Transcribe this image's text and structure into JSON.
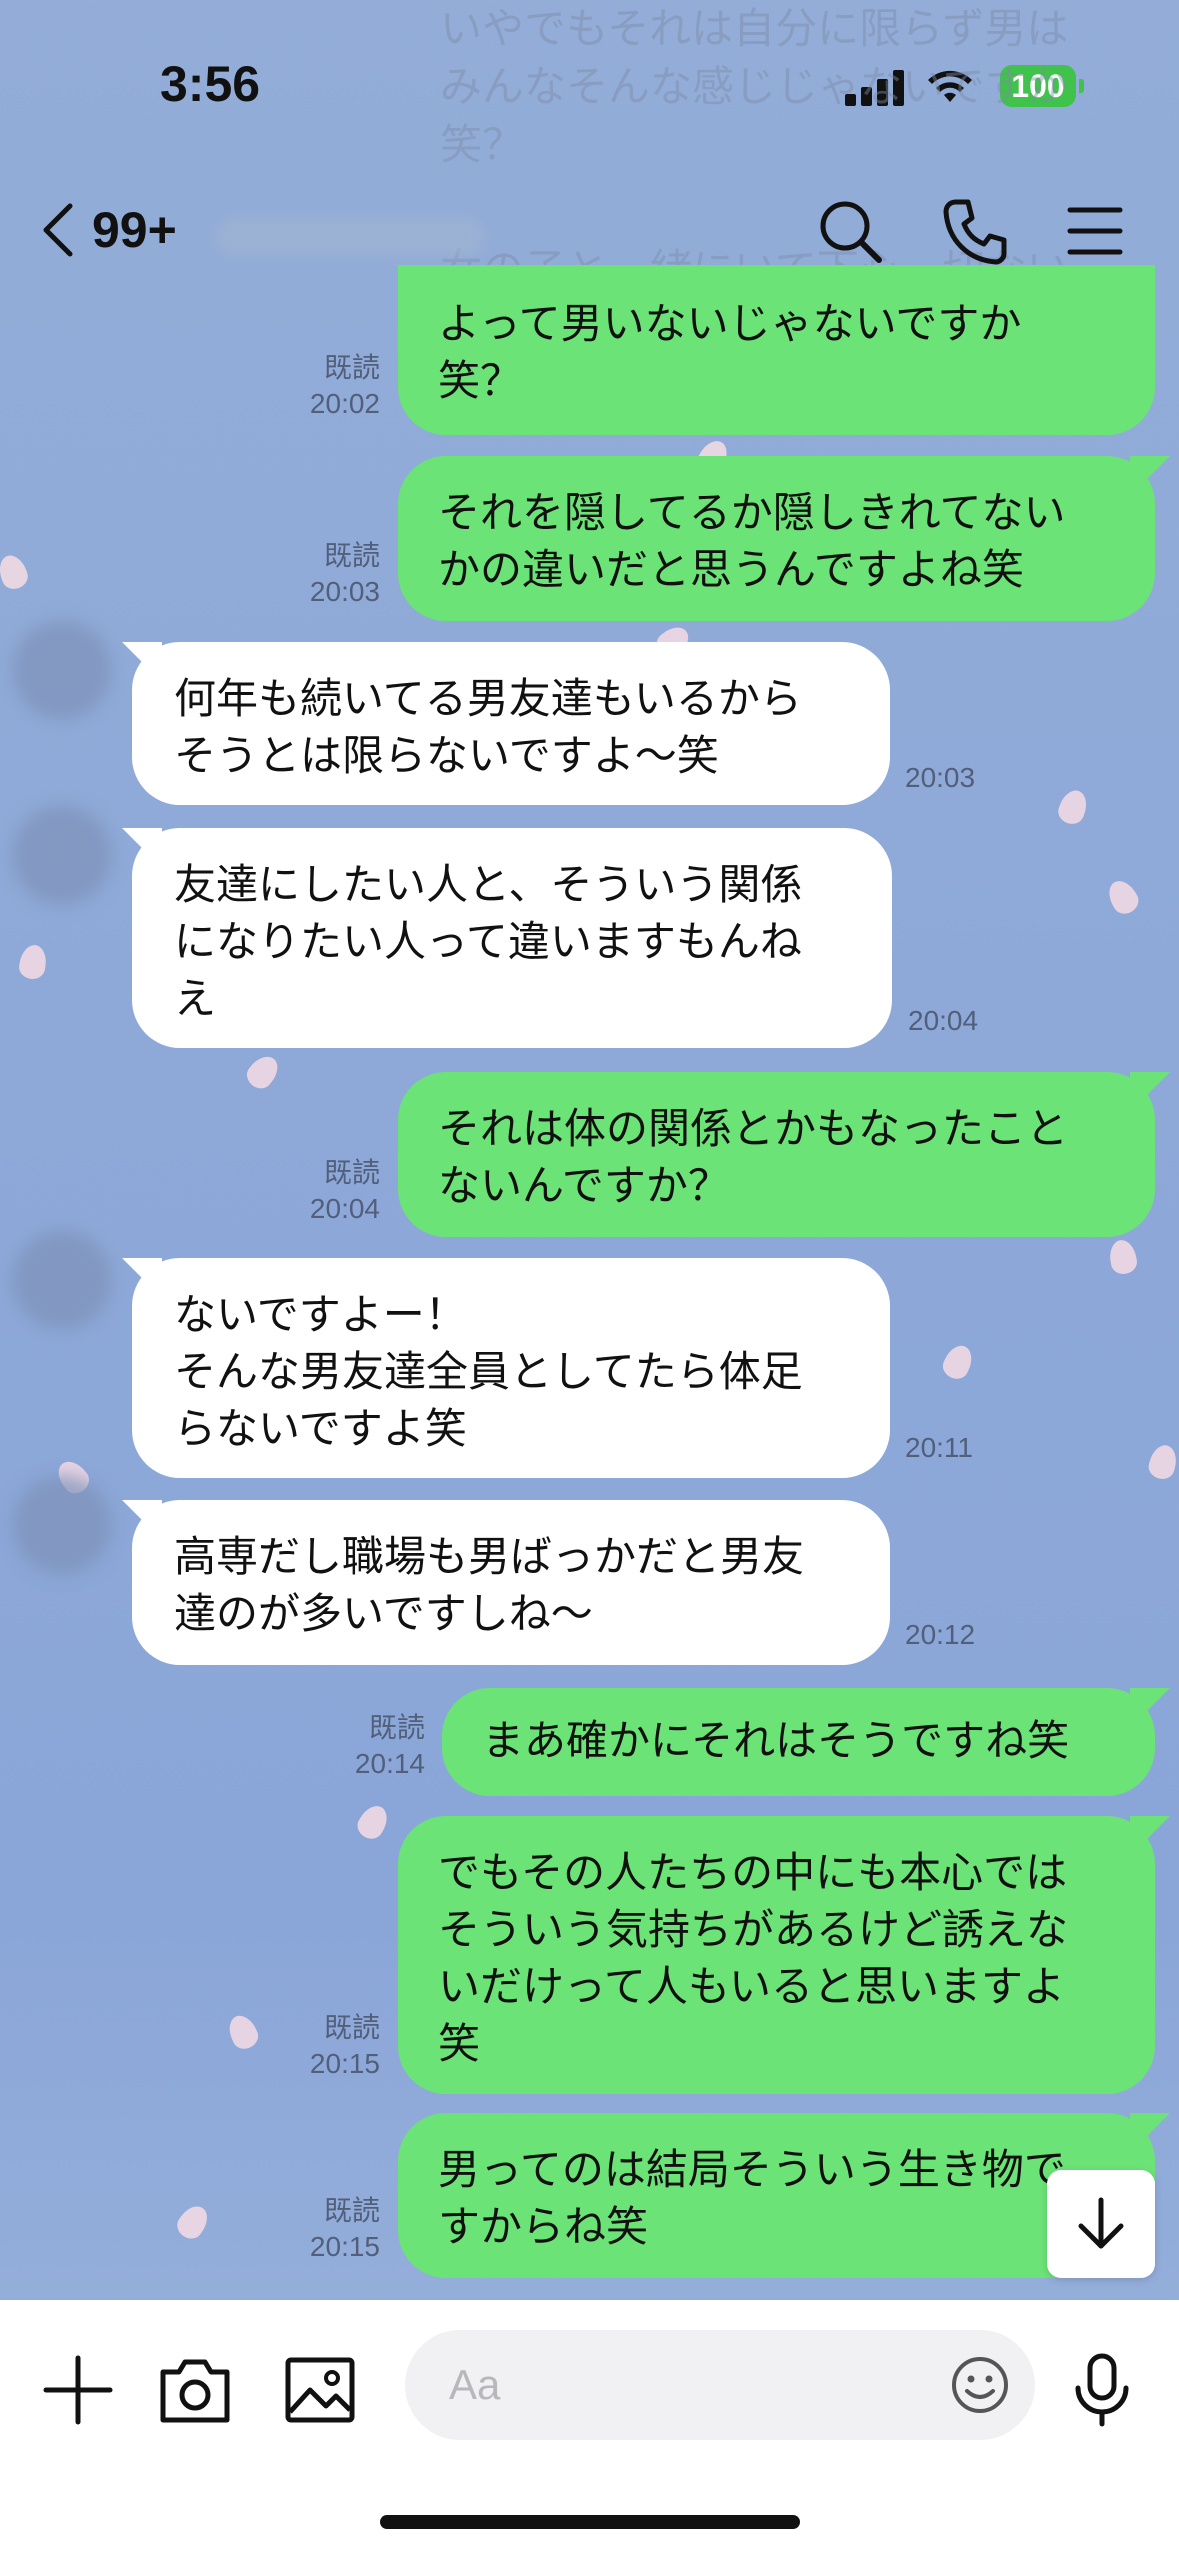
{
  "status_bar": {
    "time": "3:56",
    "battery": "100"
  },
  "faded_overlap": {
    "lines": [
      "いやでもそれは自分に限らず男は",
      "みんなそんな感じじゃないですか",
      "笑？"
    ],
    "meta": "既読\n20:02",
    "line2": "女の子と一緒にいて下心一切ない"
  },
  "header": {
    "back_label": "99+",
    "icons": [
      "search-icon",
      "phone-icon",
      "menu-icon"
    ]
  },
  "messages": [
    {
      "side": "out",
      "text": "よって男いないじゃないですか\n笑？",
      "read": "既読",
      "time": "20:02"
    },
    {
      "side": "out",
      "text": "それを隠してるか隠しきれてない\nかの違いだと思うんですよね笑",
      "read": "既読",
      "time": "20:03"
    },
    {
      "side": "in",
      "text": "何年も続いてる男友達もいるから\nそうとは限らないですよ〜笑",
      "time": "20:03"
    },
    {
      "side": "in",
      "text": "友達にしたい人と、そういう関係\nになりたい人って違いますもんね\nえ",
      "time": "20:04"
    },
    {
      "side": "out",
      "text": "それは体の関係とかもなったこと\nないんですか？",
      "read": "既読",
      "time": "20:04"
    },
    {
      "side": "in",
      "text": "ないですよー！\nそんな男友達全員としてたら体足\nらないですよ笑",
      "time": "20:11"
    },
    {
      "side": "in",
      "text": "高専だし職場も男ばっかだと男友\n達のが多いですしね〜",
      "time": "20:12"
    },
    {
      "side": "out",
      "text": "まあ確かにそれはそうですね笑",
      "read": "既読",
      "time": "20:14"
    },
    {
      "side": "out",
      "text": "でもその人たちの中にも本心では\nそういう気持ちがあるけど誘えな\nいだけって人もいると思いますよ\n笑",
      "read": "既読",
      "time": "20:15"
    },
    {
      "side": "out",
      "text": "男ってのは結局そういう生き物で\nすからね笑",
      "read": "既読",
      "time": "20:15"
    }
  ],
  "composer": {
    "placeholder": "Aa",
    "icons": [
      "plus-icon",
      "camera-icon",
      "image-icon",
      "emoji-icon",
      "microphone-icon"
    ]
  },
  "colors": {
    "outgoing_bubble": "#6ce377",
    "incoming_bubble": "#ffffff",
    "background": "#8ea9d8",
    "battery": "#3fc34b"
  }
}
